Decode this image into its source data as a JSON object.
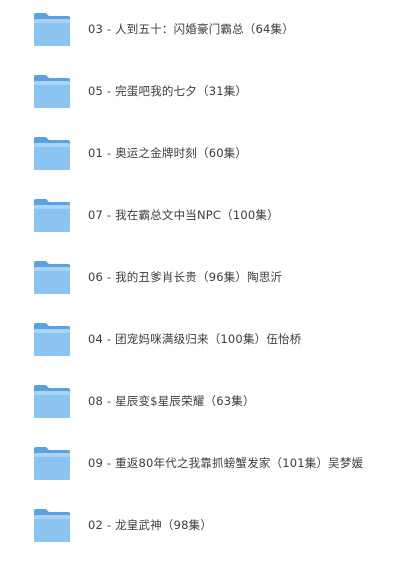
{
  "folders": [
    {
      "name": "03 - 人到五十：闪婚豪门霸总（64集）",
      "icon": "folder-icon"
    },
    {
      "name": "05 - 完蛋吧我的七夕（31集）",
      "icon": "folder-icon"
    },
    {
      "name": "01 - 奥运之金牌时刻（60集）",
      "icon": "folder-icon"
    },
    {
      "name": "07 - 我在霸总文中当NPC（100集）",
      "icon": "folder-icon"
    },
    {
      "name": "06 - 我的丑爹肖长贵（96集）陶思沂",
      "icon": "folder-icon"
    },
    {
      "name": "04 - 团宠妈咪满级归来（100集）伍怡桥",
      "icon": "folder-icon"
    },
    {
      "name": "08 - 星辰变$星辰荣耀（63集）",
      "icon": "folder-icon"
    },
    {
      "name": "09 - 重返80年代之我靠抓螃蟹发家（101集）吴梦媛",
      "icon": "folder-icon"
    },
    {
      "name": "02 - 龙皇武神（98集）",
      "icon": "folder-icon"
    }
  ],
  "colors": {
    "folder_back": "#5aa3e2",
    "folder_front": "#8cc4f1",
    "folder_front_light": "#a9d4f6",
    "text": "#3c3c3c"
  }
}
